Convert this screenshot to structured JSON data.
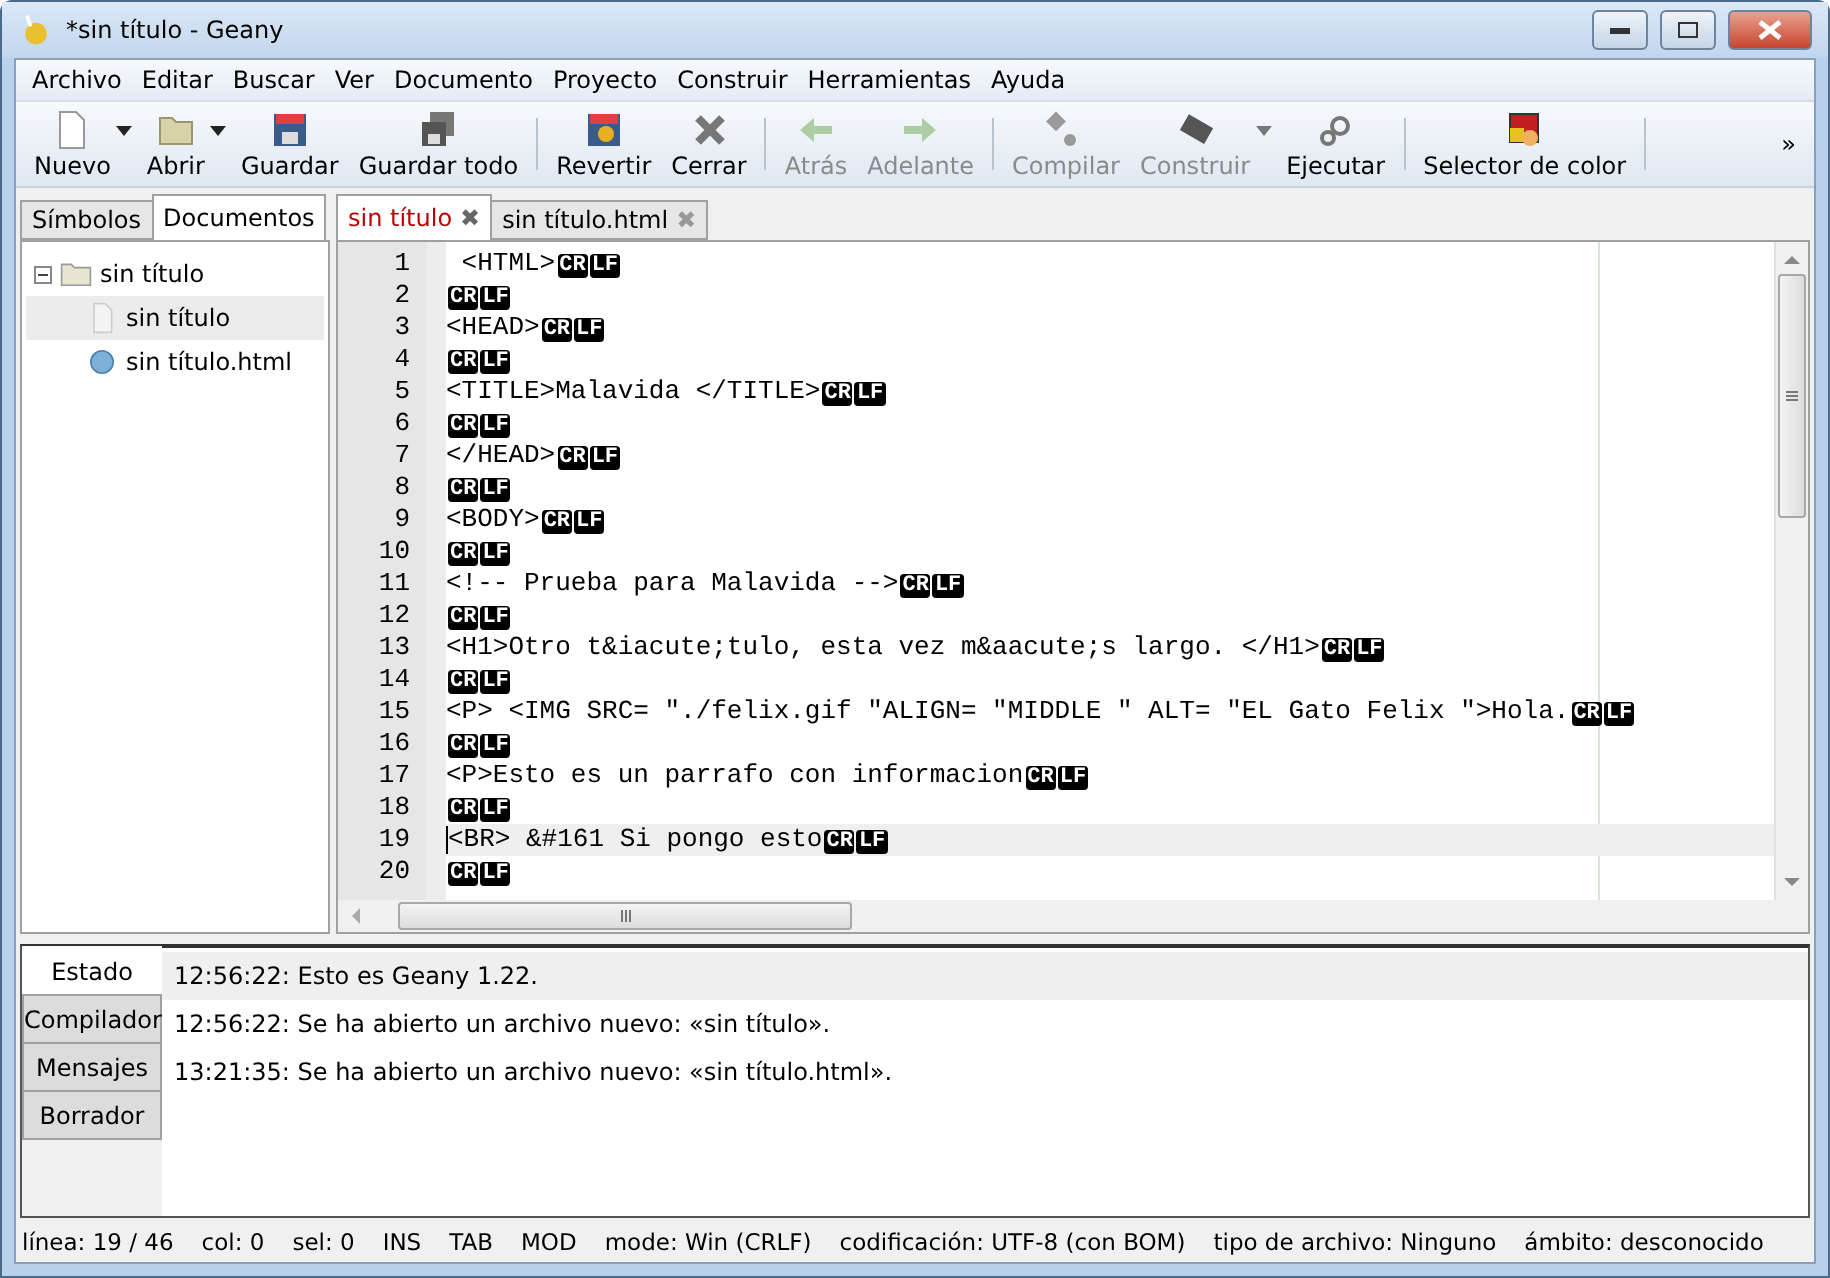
{
  "window": {
    "title": "*sin título - Geany"
  },
  "menu": [
    "Archivo",
    "Editar",
    "Buscar",
    "Ver",
    "Documento",
    "Proyecto",
    "Construir",
    "Herramientas",
    "Ayuda"
  ],
  "toolbar": [
    {
      "label": "Nuevo",
      "disabled": false,
      "dropdown": true
    },
    {
      "label": "Abrir",
      "disabled": false,
      "dropdown": true
    },
    {
      "label": "Guardar",
      "disabled": false,
      "dropdown": false
    },
    {
      "label": "Guardar todo",
      "disabled": false,
      "dropdown": false,
      "separator_after": true
    },
    {
      "label": "Revertir",
      "disabled": false,
      "dropdown": false
    },
    {
      "label": "Cerrar",
      "disabled": false,
      "dropdown": false,
      "separator_after": true
    },
    {
      "label": "Atrás",
      "disabled": true,
      "dropdown": false
    },
    {
      "label": "Adelante",
      "disabled": true,
      "dropdown": false,
      "separator_after": true
    },
    {
      "label": "Compilar",
      "disabled": true,
      "dropdown": false
    },
    {
      "label": "Construir",
      "disabled": true,
      "dropdown": true
    },
    {
      "label": "Ejecutar",
      "disabled": false,
      "dropdown": false,
      "separator_after": true
    },
    {
      "label": "Selector de color",
      "disabled": false,
      "dropdown": false,
      "separator_after": true
    }
  ],
  "toolbar_overflow": "»",
  "sidebar": {
    "tabs": [
      {
        "label": "Símbolos",
        "selected": false
      },
      {
        "label": "Documentos",
        "selected": true
      }
    ],
    "tree": [
      {
        "label": "sin título",
        "expanded": true,
        "children": [
          {
            "label": "sin título",
            "selected": true
          },
          {
            "label": "sin título.html",
            "selected": false
          }
        ]
      }
    ]
  },
  "editor": {
    "tabs": [
      {
        "label": "sin título",
        "modified": true,
        "selected": true,
        "close": "✖"
      },
      {
        "label": "sin título.html",
        "modified": false,
        "selected": false,
        "close": "✖"
      }
    ],
    "lines": [
      {
        "number": "1",
        "code": " <HTML>",
        "eol": [
          "CR",
          "LF"
        ],
        "current": false
      },
      {
        "number": "2",
        "eol": [
          "CR",
          "LF"
        ],
        "current": false
      },
      {
        "number": "3",
        "code": "<HEAD>",
        "eol": [
          "CR",
          "LF"
        ],
        "current": false
      },
      {
        "number": "4",
        "eol": [
          "CR",
          "LF"
        ],
        "current": false
      },
      {
        "number": "5",
        "code": "<TITLE>Malavida </TITLE>",
        "eol": [
          "CR",
          "LF"
        ],
        "current": false
      },
      {
        "number": "6",
        "eol": [
          "CR",
          "LF"
        ],
        "current": false
      },
      {
        "number": "7",
        "code": "</HEAD>",
        "eol": [
          "CR",
          "LF"
        ],
        "current": false
      },
      {
        "number": "8",
        "eol": [
          "CR",
          "LF"
        ],
        "current": false
      },
      {
        "number": "9",
        "code": "<BODY>",
        "eol": [
          "CR",
          "LF"
        ],
        "current": false
      },
      {
        "number": "10",
        "eol": [
          "CR",
          "LF"
        ],
        "current": false
      },
      {
        "number": "11",
        "code": "<!-- Prueba para Malavida -->",
        "eol": [
          "CR",
          "LF"
        ],
        "current": false
      },
      {
        "number": "12",
        "eol": [
          "CR",
          "LF"
        ],
        "current": false
      },
      {
        "number": "13",
        "code": "<H1>Otro t&iacute;tulo, esta vez m&aacute;s largo. </H1>",
        "eol": [
          "CR",
          "LF"
        ],
        "current": false
      },
      {
        "number": "14",
        "eol": [
          "CR",
          "LF"
        ],
        "current": false
      },
      {
        "number": "15",
        "code": "<P> <IMG SRC= \"./felix.gif \"ALIGN= \"MIDDLE \" ALT= \"EL Gato Felix \">Hola.",
        "eol": [
          "CR",
          "LF"
        ],
        "current": false
      },
      {
        "number": "16",
        "eol": [
          "CR",
          "LF"
        ],
        "current": false
      },
      {
        "number": "17",
        "code": "<P>Esto es un parrafo con informacion",
        "eol": [
          "CR",
          "LF"
        ],
        "current": false
      },
      {
        "number": "18",
        "eol": [
          "CR",
          "LF"
        ],
        "current": false
      },
      {
        "number": "19",
        "code": "<BR> &#161 Si pongo esto",
        "eol": [
          "CR",
          "LF"
        ],
        "current": true
      },
      {
        "number": "20",
        "eol": [
          "CR",
          "LF"
        ],
        "current": false
      }
    ]
  },
  "messages": {
    "tabs": [
      {
        "label": "Estado",
        "selected": true
      },
      {
        "label": "Compilador",
        "selected": false
      },
      {
        "label": "Mensajes",
        "selected": false
      },
      {
        "label": "Borrador",
        "selected": false
      }
    ],
    "rows": [
      {
        "text": "12:56:22: Esto es Geany 1.22.",
        "selected": true
      },
      {
        "text": "12:56:22: Se ha abierto un archivo nuevo: «sin título».",
        "selected": false
      },
      {
        "text": "13:21:35: Se ha abierto un archivo nuevo: «sin título.html».",
        "selected": false
      }
    ]
  },
  "status_bar": [
    "línea: 19 / 46",
    "col: 0",
    "sel: 0",
    "INS",
    "TAB",
    "MOD",
    "mode: Win (CRLF)",
    "codificación: UTF-8 (con BOM)",
    "tipo de archivo: Ninguno",
    "ámbito: desconocido"
  ]
}
